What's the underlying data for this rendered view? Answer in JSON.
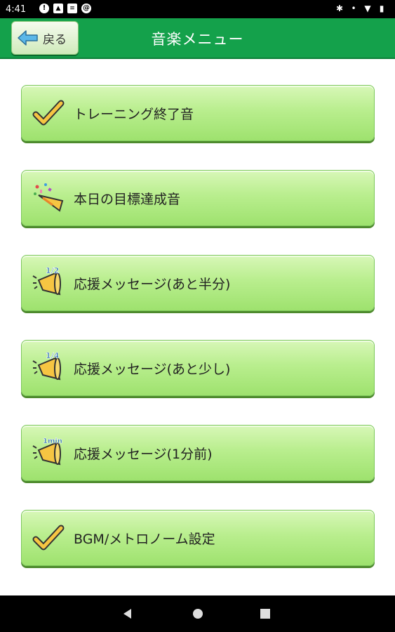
{
  "status_bar": {
    "time": "4:41",
    "left_icons": [
      "notification-circle-icon",
      "image-icon",
      "file-icon",
      "at-sign-icon"
    ],
    "right_icons": [
      "bluetooth-icon",
      "dot-icon",
      "wifi-icon",
      "battery-icon"
    ]
  },
  "header": {
    "back_label": "戻る",
    "title": "音楽メニュー",
    "color": "#14a14b"
  },
  "menu": {
    "items": [
      {
        "label": "トレーニング終了音",
        "icon": "checkmark-icon"
      },
      {
        "label": "本日の目標達成音",
        "icon": "party-popper-icon"
      },
      {
        "label": "応援メッセージ(あと半分)",
        "icon": "megaphone-icon",
        "badge": "1/2"
      },
      {
        "label": "応援メッセージ(あと少し)",
        "icon": "megaphone-icon",
        "badge": "1/4"
      },
      {
        "label": "応援メッセージ(1分前)",
        "icon": "megaphone-icon",
        "badge": "1min"
      },
      {
        "label": "BGM/メトロノーム設定",
        "icon": "checkmark-icon"
      }
    ]
  },
  "nav_bar": {
    "buttons": [
      "back-triangle-icon",
      "home-circle-icon",
      "recents-square-icon"
    ]
  }
}
